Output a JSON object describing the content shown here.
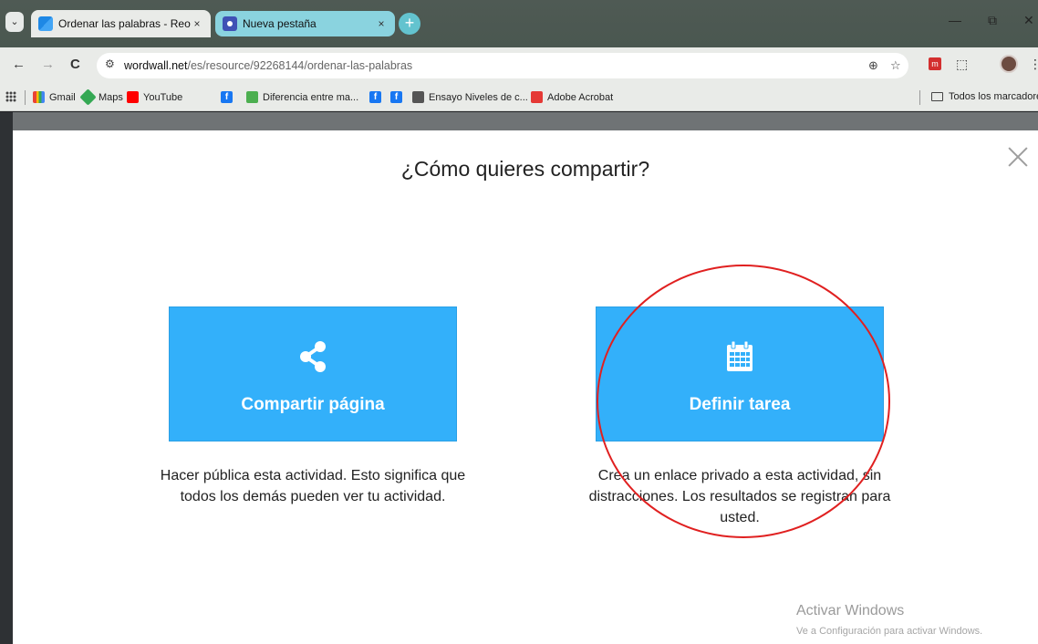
{
  "browser": {
    "tabs": [
      {
        "title": "Ordenar las palabras - Reorden",
        "close": "×"
      },
      {
        "title": "Nueva pestaña",
        "close": "×"
      }
    ],
    "new_tab": "+",
    "window_controls": {
      "minimize": "—",
      "restore": "⧉",
      "close": "✕"
    },
    "nav": {
      "back": "←",
      "forward": "→",
      "reload": "C"
    },
    "url": {
      "domain": "wordwall.net",
      "path": "/es/resource/92268144/ordenar-las-palabras"
    },
    "omni_icons": {
      "zoom": "⊕",
      "star": "☆"
    },
    "toolbar_icons": {
      "extensions": "⬚",
      "menu": "⋮",
      "ext_m": "m"
    },
    "bookmarks": [
      {
        "label": "Gmail",
        "icon": "gmail-icon"
      },
      {
        "label": "Maps",
        "icon": "maps-icon"
      },
      {
        "label": "YouTube",
        "icon": "youtube-icon"
      },
      {
        "label": "",
        "icon": "facebook-icon"
      },
      {
        "label": "Diferencia entre ma...",
        "icon": "globe-icon"
      },
      {
        "label": "",
        "icon": "facebook-icon"
      },
      {
        "label": "",
        "icon": "facebook-icon"
      },
      {
        "label": "Ensayo Niveles de c...",
        "icon": "globe-icon"
      },
      {
        "label": "Adobe Acrobat",
        "icon": "acrobat-icon"
      }
    ],
    "all_bookmarks": "Todos los marcadores"
  },
  "modal": {
    "title": "¿Cómo quieres compartir?",
    "options": [
      {
        "label": "Compartir página",
        "icon": "share-icon",
        "description": "Hacer pública esta actividad. Esto significa que todos los demás pueden ver tu actividad."
      },
      {
        "label": "Definir tarea",
        "icon": "calendar-icon",
        "description": "Crea un enlace privado a esta actividad, sin distracciones. Los resultados se registran para usted."
      }
    ],
    "accent_color": "#33b0fa"
  },
  "watermark": {
    "line1": "Activar Windows",
    "line2": "Ve a Configuración para activar Windows."
  }
}
